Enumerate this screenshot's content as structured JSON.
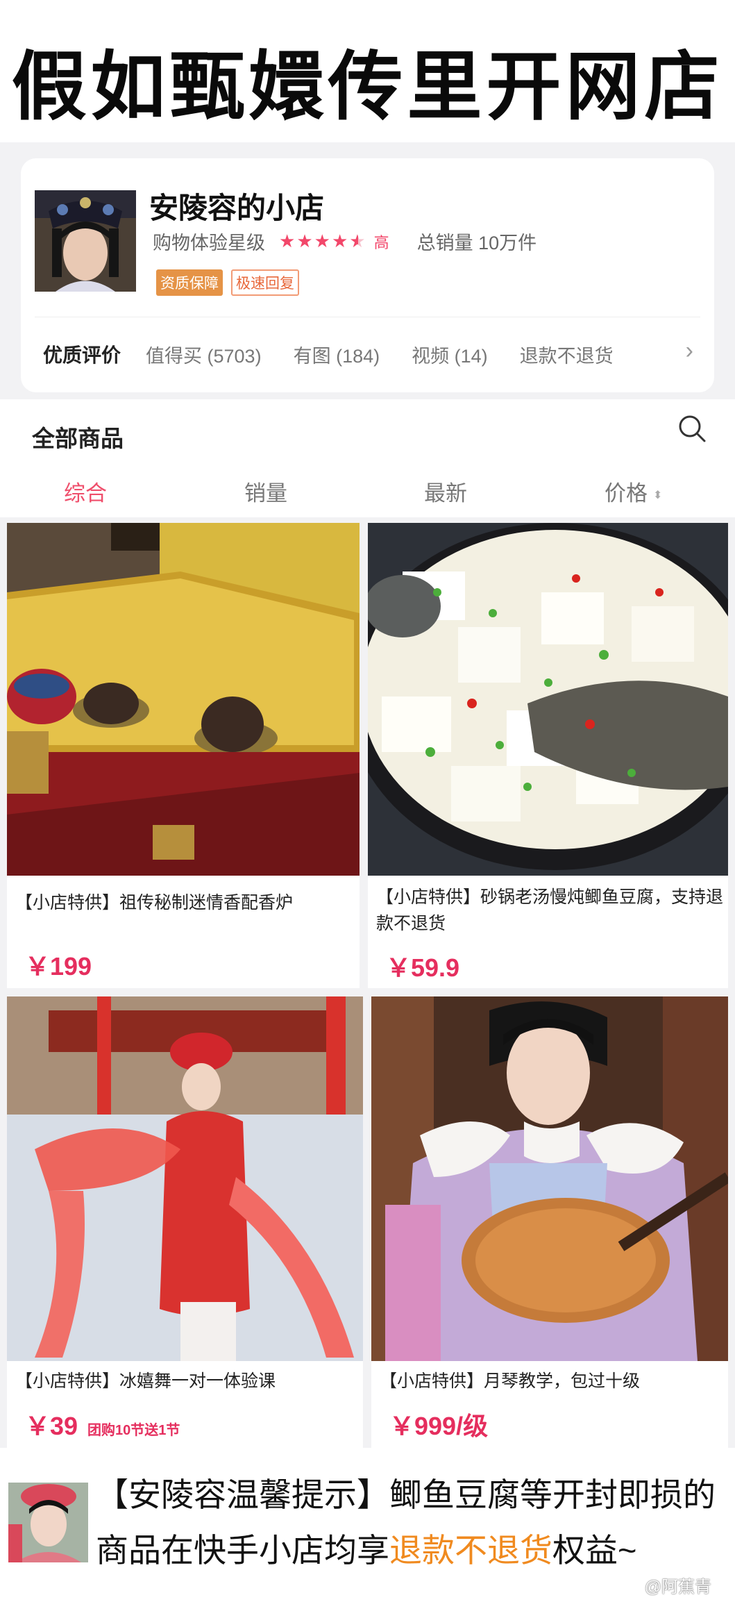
{
  "header": {
    "title": "假如甄嬛传里开网店"
  },
  "shop": {
    "name": "安陵容的小店",
    "experience_label": "购物体验星级",
    "rating": 4.5,
    "grade": "高",
    "sales_label": "总销量 10万件",
    "badges": [
      "资质保障",
      "极速回复"
    ]
  },
  "reviews": {
    "heading": "优质评价",
    "tags": [
      "值得买 (5703)",
      "有图 (184)",
      "视频 (14)",
      "退款不退货"
    ]
  },
  "filter": {
    "all_products": "全部商品",
    "sorts": [
      "综合",
      "销量",
      "最新",
      "价格"
    ],
    "active_sort": "综合"
  },
  "products": [
    {
      "name": "【小店特供】祖传秘制迷情香配香炉",
      "price": "￥199",
      "extra": ""
    },
    {
      "name": "【小店特供】砂锅老汤慢炖鲫鱼豆腐，支持退款不退货",
      "price": "￥59.9",
      "extra": ""
    },
    {
      "name": "【小店特供】冰嬉舞一对一体验课",
      "price": "￥39",
      "extra": "团购10节送1节"
    },
    {
      "name": "【小店特供】月琴教学，包过十级",
      "price": "￥999/级",
      "extra": ""
    }
  ],
  "footer": {
    "tip_part1": "【安陵容温馨提示】鲫鱼豆腐等开封即损的商品在快手小店均享",
    "tip_highlight": "退款不退货",
    "tip_part2": "权益~",
    "watermark": "@阿蕉青"
  },
  "colors": {
    "accent": "#ef4e6b",
    "price": "#e52e5e",
    "highlight": "#f08a1f",
    "badge": "#e59346"
  }
}
